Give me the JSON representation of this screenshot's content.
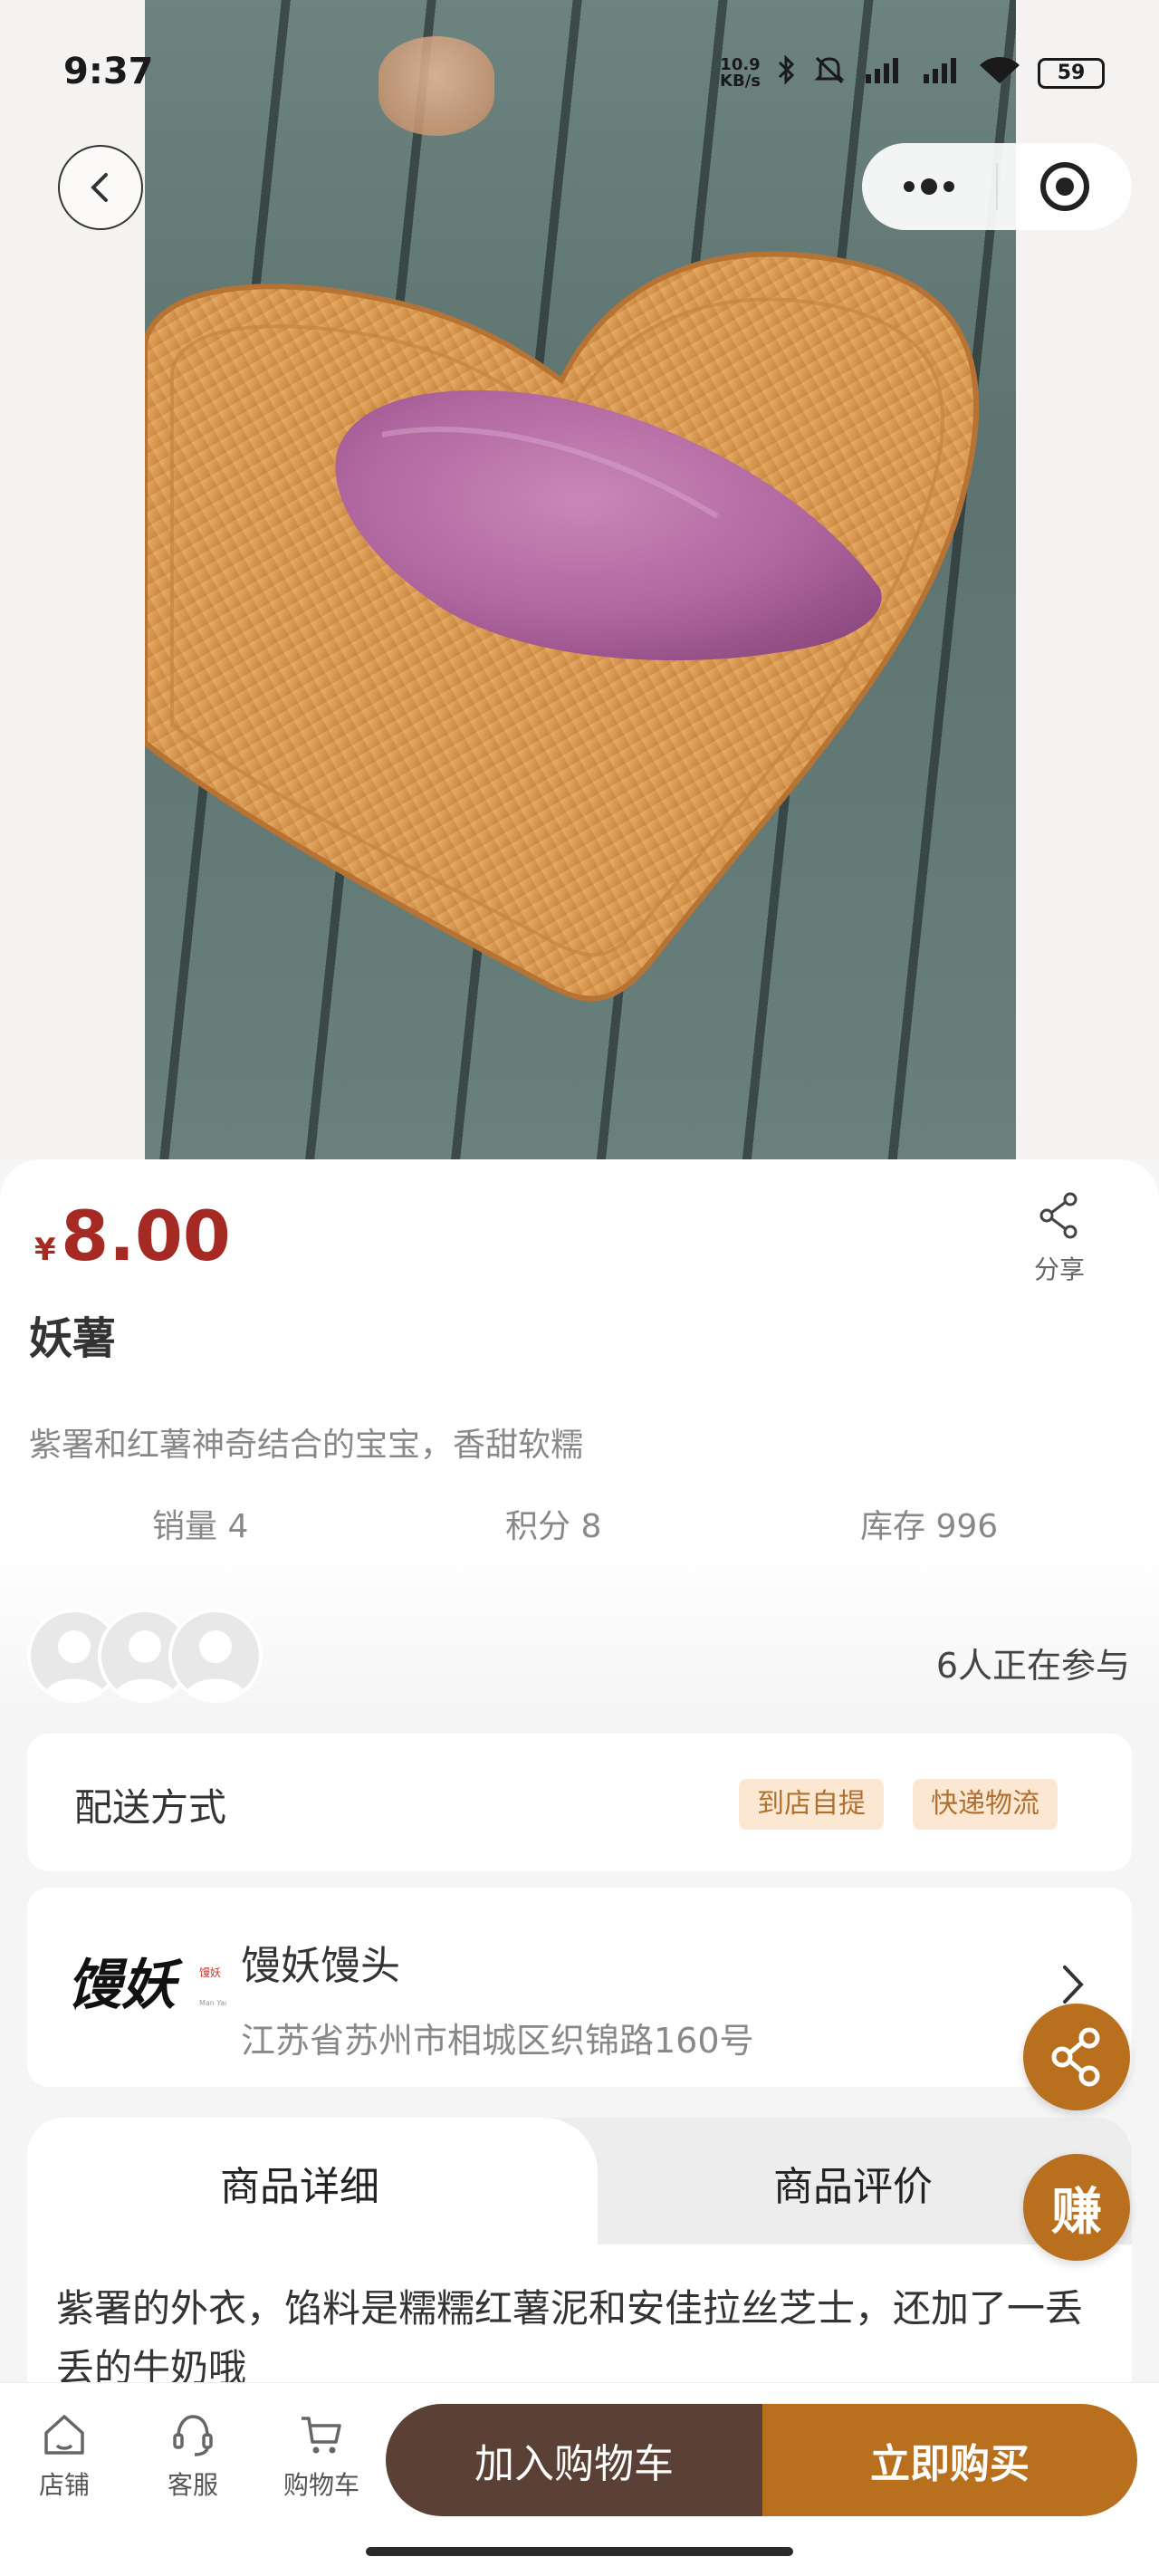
{
  "status_bar": {
    "time": "9:37",
    "speed_value": "10.9",
    "speed_unit": "KB/s",
    "battery": "59",
    "icons": [
      "bluetooth-icon",
      "mute-icon",
      "signal-icon",
      "signal-icon",
      "wifi-icon",
      "battery-icon"
    ]
  },
  "nav": {
    "back_icon": "back-icon",
    "menu_icon": "more-icon",
    "close_icon": "target-icon"
  },
  "product": {
    "currency": "¥",
    "price": "8.00",
    "name": "妖薯",
    "description": "紫署和红薯神奇结合的宝宝，香甜软糯",
    "share_label": "分享",
    "stats": {
      "sales": "销量 4",
      "points": "积分 8",
      "stock": "库存 996"
    },
    "participants": "6人正在参与"
  },
  "delivery": {
    "label": "配送方式",
    "options": [
      "到店自提",
      "快递物流"
    ]
  },
  "store": {
    "name": "馒妖馒头",
    "address": "江苏省苏州市相城区织锦路160号",
    "logo_text": "馒妖",
    "logo_seal": "馒妖",
    "logo_sub": "Man Yao"
  },
  "tabs": {
    "details": "商品详细",
    "reviews": "商品评价"
  },
  "detail_text": "紫署的外衣，馅料是糯糯红薯泥和安佳拉丝芝士，还加了一丢丢的牛奶哦",
  "floating": {
    "earn_label": "赚"
  },
  "bottom_nav": {
    "store": "店铺",
    "service": "客服",
    "cart": "购物车",
    "add_to_cart": "加入购物车",
    "buy_now": "立即购买"
  },
  "colors": {
    "price": "#a52a24",
    "accent": "#b8701e",
    "dark_button": "#5a4035",
    "tag_bg": "#fbe7d2"
  }
}
